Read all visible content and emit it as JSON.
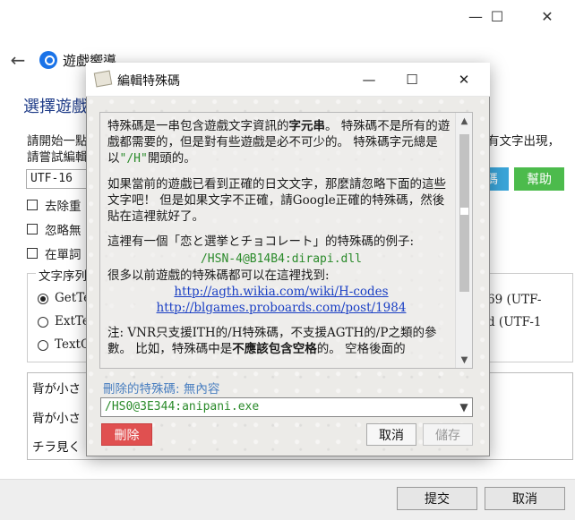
{
  "outer_window": {
    "caption": {
      "minimize": "—",
      "maximize": "☐",
      "close": "✕"
    },
    "wizard_title": "遊戲嚮導",
    "back_glyph": "←",
    "heading": "選擇遊戲",
    "desc_line1": "請開始一點",
    "desc_line2": "請嘗試編輯",
    "desc_right": "有文字出現，",
    "encoding_value": "UTF-16",
    "checkboxes": [
      "去除重",
      "忽略無",
      "在單詞"
    ],
    "group_title": "文字序列",
    "radios": [
      {
        "label": "GetTe",
        "checked": true
      },
      {
        "label": "ExtTe",
        "checked": false
      },
      {
        "label": "TextO",
        "checked": false
      }
    ],
    "right_blue_button": "碼",
    "help_button": "幫助",
    "right_radio1": "e69 (UTF-",
    "right_radio2": "ed (UTF-1",
    "text_lines": [
      "背が小さ",
      "背が小さ",
      "チラ見く"
    ],
    "bottom": {
      "submit": "提交",
      "cancel": "取消"
    }
  },
  "dialog": {
    "title": "編輯特殊碼",
    "caption": {
      "minimize": "—",
      "maximize": "☐",
      "close": "✕"
    },
    "help": {
      "p1_a": "特殊碼是一串包含遊戲文字資訊的",
      "p1_bold": "字元串",
      "p1_b": "。 特殊碼不是所有的遊戲都需要的，但是對有些遊戲是必不可少的。 特殊碼字元總是以",
      "p1_code": "\"/H\"",
      "p1_c": "開頭的。",
      "p2": "如果當前的遊戲已看到正確的日文文字，那麼請忽略下面的這些文字吧！ 但是如果文字不正確，請Google正確的特殊碼，然後貼在這裡就好了。",
      "p3": "這裡有一個「恋と選挙とチョコレート」的特殊碼的例子:",
      "example_code": "/HSN-4@B14B4:dirapi.dll",
      "p4": "很多以前遊戲的特殊碼都可以在這裡找到:",
      "link1": "http://agth.wikia.com/wiki/H-codes",
      "link2": "http://blgames.proboards.com/post/1984",
      "p5_a": "注: VNR只支援ITH的/H特殊碼，不支援AGTH的/P之類的參數。 比如，特殊碼中是",
      "p5_bold": "不應該包含空格",
      "p5_b": "的。 空格後面的"
    },
    "deleted_label": "刪除的特殊碼: 無內容",
    "code_value": "/HS0@3E344:anipani.exe",
    "buttons": {
      "delete": "刪除",
      "cancel": "取消",
      "save": "儲存"
    }
  }
}
